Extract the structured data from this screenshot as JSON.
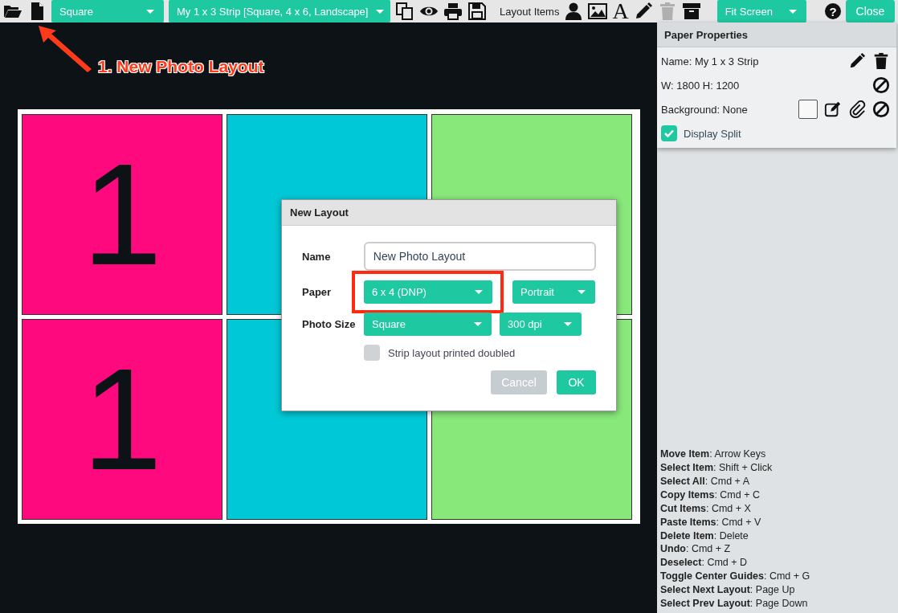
{
  "toolbar": {
    "left_tools": [
      {
        "kind": "folder",
        "disabled": false
      },
      {
        "kind": "file",
        "disabled": false
      }
    ],
    "selects": [
      {
        "value": "Square"
      },
      {
        "value": "My 1 x 3 Strip [Square, 4 x 6, Landscape]"
      }
    ],
    "file_tools": [
      {
        "kind": "copy",
        "disabled": false
      },
      {
        "kind": "eye",
        "disabled": false
      },
      {
        "kind": "print",
        "disabled": false
      },
      {
        "kind": "save",
        "disabled": false
      }
    ],
    "layout_items_label": "Layout Items",
    "item_tools": [
      {
        "kind": "person",
        "disabled": false
      },
      {
        "kind": "image",
        "disabled": false
      },
      {
        "kind": "text",
        "glyph": "A",
        "disabled": false
      },
      {
        "kind": "pencil",
        "disabled": false
      },
      {
        "kind": "trash",
        "disabled": true
      },
      {
        "kind": "archive",
        "disabled": false
      }
    ],
    "zoom_select": "Fit Screen",
    "help": "?",
    "close": "Close"
  },
  "annotation": {
    "text": "1. New Photo Layout"
  },
  "canvas": {
    "cells": [
      {
        "label": "1",
        "color": "#ff0a7e"
      },
      {
        "color": "#00c8d6"
      },
      {
        "color": "#88e87a"
      },
      {
        "label": "1",
        "color": "#ff0a7e"
      },
      {
        "color": "#00c8d6"
      },
      {
        "color": "#88e87a"
      }
    ]
  },
  "dialog": {
    "title": "New Layout",
    "name_label": "Name",
    "name_value": "New Photo Layout",
    "rows": [
      {
        "label": "Paper",
        "selects": [
          {
            "value": "6 x 4 (DNP)",
            "highlighted": true
          },
          {
            "value": "Portrait",
            "highlighted": false
          }
        ]
      },
      {
        "label": "Photo Size",
        "selects": [
          {
            "value": "Square",
            "highlighted": false
          },
          {
            "value": "300 dpi",
            "highlighted": false
          }
        ]
      }
    ],
    "strip_doubled": {
      "label": "Strip layout printed doubled",
      "checked": false
    },
    "buttons": [
      {
        "label": "Cancel",
        "disabled": true
      },
      {
        "label": "OK",
        "disabled": false
      }
    ]
  },
  "paper_properties": {
    "title": "Paper Properties",
    "name": "Name: My 1 x 3 Strip",
    "size": "W: 1800 H: 1200",
    "background": "Background: None",
    "display_split": {
      "label": "Display Split",
      "checked": true
    }
  },
  "shortcuts": [
    "**Move Item**: Arrow Keys",
    "**Select Item**: Shift + Click",
    "**Select All**: Cmd + A",
    "**Copy Items**: Cmd + C",
    "**Cut Items**: Cmd + X",
    "**Paste Items**: Cmd + V",
    "**Delete Item**: Delete",
    "**Undo**: Cmd + Z",
    "**Deselect**: Cmd + D",
    "**Toggle Center Guides**: Cmd + G",
    "**Select Next Layout**: Page Up",
    "**Select Prev Layout**: Page Down"
  ]
}
